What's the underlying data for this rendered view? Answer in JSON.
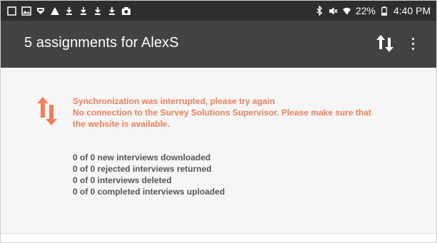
{
  "status_bar": {
    "left_icons": [
      "notification-square-icon",
      "gallery-icon",
      "badge-icon",
      "warning-icon",
      "download-icon",
      "download-icon",
      "download-icon",
      "download-icon",
      "camera-icon"
    ],
    "right_icons": [
      "bluetooth-icon",
      "mute-icon",
      "wifi-icon",
      "battery-icon"
    ],
    "battery_text": "22%",
    "time": "4:40 PM"
  },
  "app_bar": {
    "title": "5 assignments for AlexS",
    "sync_icon": "sync-arrows-icon",
    "menu_icon": "more-vert-icon"
  },
  "sync_status": {
    "icon": "sync-error-arrows-icon",
    "error_title": "Synchronization was interrupted, please try again",
    "error_message_line1": "No connection to the Survey Solutions Supervisor. Please make sure that",
    "error_message_line2": "the website is available.",
    "stats": [
      "0 of 0 new interviews downloaded",
      "0 of 0 rejected interviews returned",
      "0 of 0 interviews deleted",
      "0 of 0 completed interviews uploaded"
    ]
  },
  "colors": {
    "status_bar": "#2e2e2e",
    "app_bar": "#424242",
    "error": "#f27e5c",
    "stats_text": "#555555",
    "content_bg": "#f6f6f6"
  }
}
